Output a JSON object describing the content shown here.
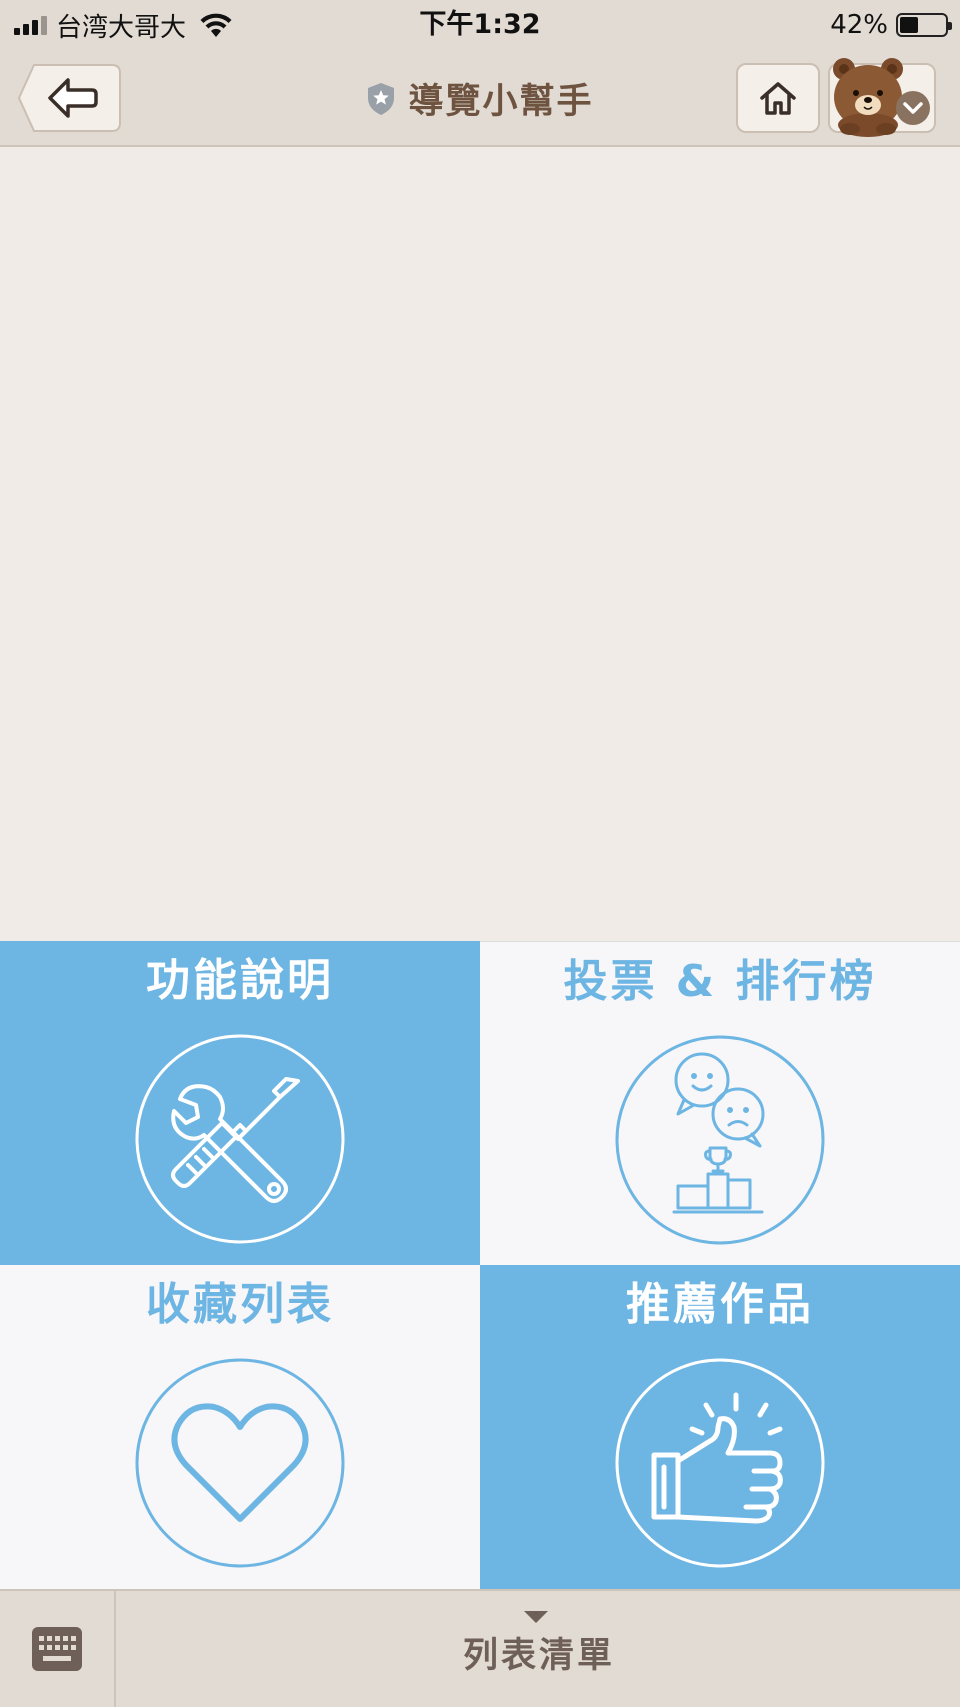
{
  "status_bar": {
    "carrier": "台湾大哥大",
    "time": "下午1:32",
    "battery": "42%",
    "battery_level": 0.42
  },
  "nav": {
    "title": "導覽小幫手",
    "icons": {
      "back": "back-arrow-icon",
      "home": "home-icon",
      "menu": "chevron-down-icon",
      "title": "shield-star-icon"
    }
  },
  "menu": {
    "tiles": [
      {
        "label": "功能說明",
        "icon": "tools-icon"
      },
      {
        "label": "投票 & 排行榜",
        "icon": "vote-ranking-icon"
      },
      {
        "label": "收藏列表",
        "icon": "heart-icon"
      },
      {
        "label": "推薦作品",
        "icon": "thumbs-up-icon"
      }
    ]
  },
  "bottom_bar": {
    "label": "列表清單",
    "keyboard_icon": "keyboard-icon"
  },
  "colors": {
    "accent_blue": "#6db5e3",
    "bar_beige": "#e2dbd3",
    "title_brown": "#6e5440",
    "background": "#f0ebe6"
  }
}
